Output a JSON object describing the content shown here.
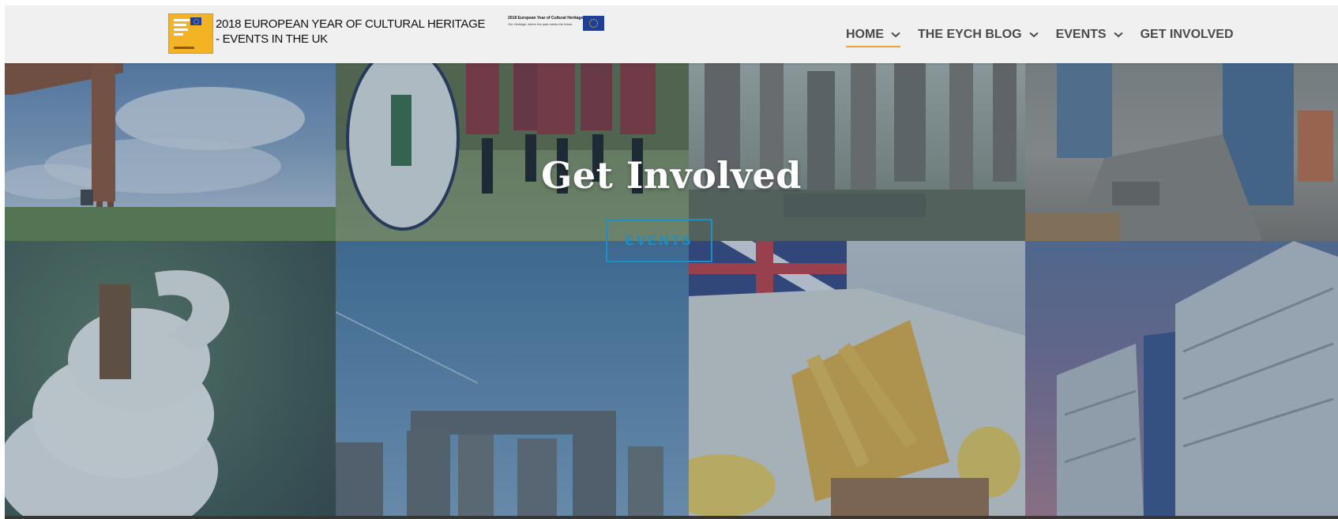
{
  "header": {
    "site_title_line1": "2018 EUROPEAN YEAR OF CULTURAL HERITAGE",
    "site_title_line2": "- EVENTS IN THE UK",
    "mini_logo_title": "2018 European Year of Cultural Heritage",
    "mini_logo_tagline": "Our Heritage: where the past meets the future"
  },
  "nav": {
    "items": [
      {
        "label": "HOME",
        "has_dropdown": true,
        "active": true
      },
      {
        "label": "THE EYCH BLOG",
        "has_dropdown": true,
        "active": false
      },
      {
        "label": "EVENTS",
        "has_dropdown": true,
        "active": false
      },
      {
        "label": "GET INVOLVED",
        "has_dropdown": false,
        "active": false
      }
    ]
  },
  "hero": {
    "heading": "Get Involved",
    "button_label": "EVENTS"
  },
  "colors": {
    "accent_underline": "#f2a22a",
    "button_blue": "#1b8fc7",
    "nav_text": "#4a4a4a",
    "logo_yellow": "#f4b324",
    "eu_blue": "#1f3f96"
  },
  "icons": {
    "dropdown": "chevron-down-icon",
    "eu_flag": "eu-flag-icon"
  }
}
